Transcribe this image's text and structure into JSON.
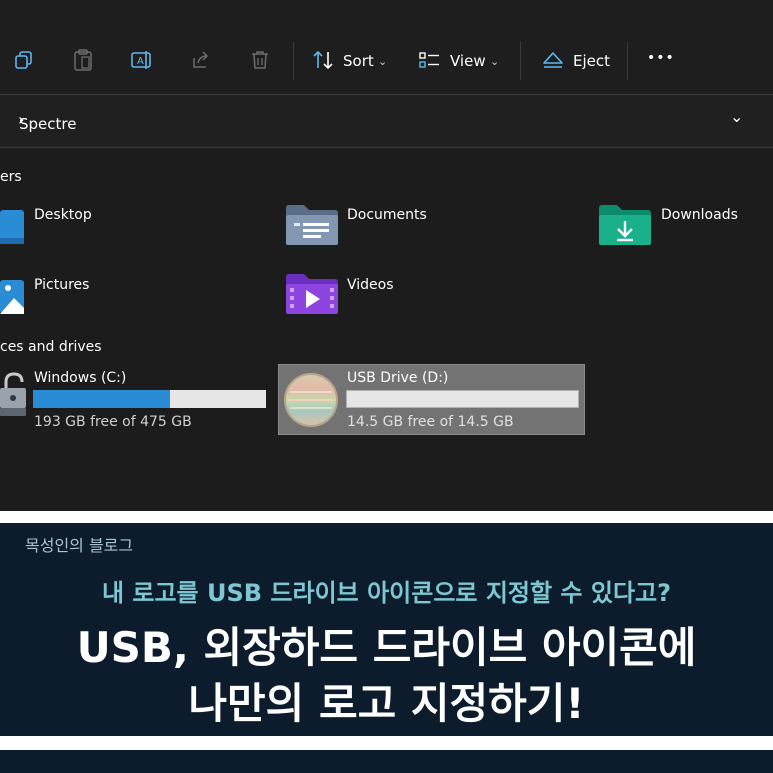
{
  "toolbar": {
    "sort_label": "Sort",
    "view_label": "View",
    "eject_label": "Eject",
    "more_label": "•••"
  },
  "address": {
    "crumb_sep": "›",
    "location": "Spectre",
    "dropdown": "⌄"
  },
  "folders": {
    "section_title": "ers",
    "items": [
      {
        "label": "Desktop"
      },
      {
        "label": "Documents"
      },
      {
        "label": "Downloads"
      },
      {
        "label": "Pictures"
      },
      {
        "label": "Videos"
      }
    ]
  },
  "drives": {
    "section_title": "ces and drives",
    "items": [
      {
        "label": "Windows (C:)",
        "free_text": "193 GB free of 475 GB",
        "used_fraction": 0.59
      },
      {
        "label": "USB Drive (D:)",
        "free_text": "14.5 GB free of 14.5 GB",
        "used_fraction": 0.0
      }
    ]
  },
  "banner": {
    "blog_name": "목성인의 블로그",
    "subtitle": "내 로고를 USB 드라이브 아이콘으로 지정할 수 있다고?",
    "title_line1": "USB, 외장하드 드라이브 아이콘에",
    "title_line2": "나만의 로고 지정하기!"
  },
  "colors": {
    "accent": "#2b8cd6",
    "banner_bg": "#0d1c2c",
    "subtitle": "#7dc6d2"
  },
  "icons": [
    "copy-icon",
    "paste-icon",
    "rename-icon",
    "share-icon",
    "delete-icon",
    "sort-icon",
    "view-icon",
    "eject-icon",
    "more-icon",
    "desktop-folder-icon",
    "documents-folder-icon",
    "downloads-folder-icon",
    "pictures-folder-icon",
    "videos-folder-icon",
    "drive-c-icon",
    "usb-drive-icon"
  ]
}
